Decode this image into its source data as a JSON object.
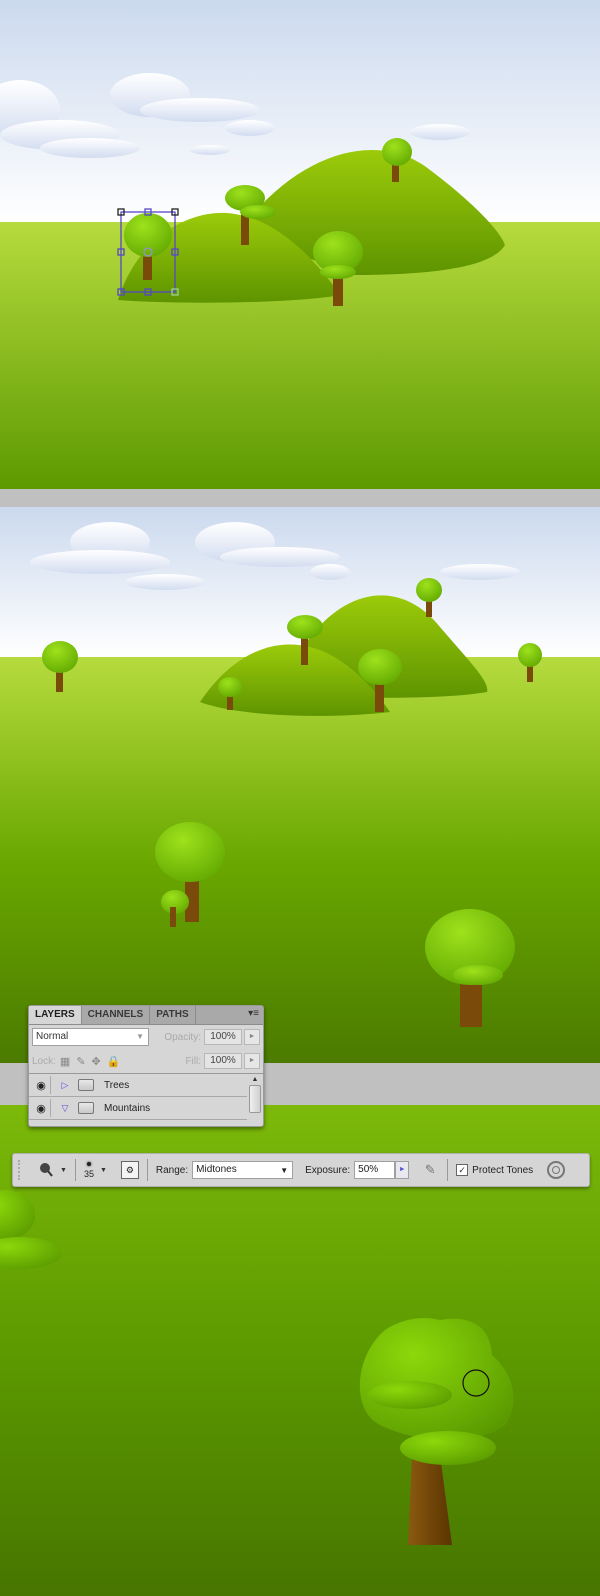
{
  "colors": {
    "sky_top": "#cfdcef",
    "sky_bottom": "#ffffff",
    "grass_light": "#b4db3a",
    "grass_dark": "#4b7a00",
    "hill": "#8cbd08",
    "foliage": "#84cc10",
    "trunk": "#7a4a0a",
    "separator": "#c0c0c0",
    "transform_box": "#5548c8"
  },
  "layers_panel": {
    "tabs": [
      {
        "label": "LAYERS",
        "active": true
      },
      {
        "label": "CHANNELS",
        "active": false
      },
      {
        "label": "PATHS",
        "active": false
      }
    ],
    "menu_icon": "panel-menu-icon",
    "blend_mode": "Normal",
    "opacity_label": "Opacity:",
    "opacity_value": "100%",
    "lock_label": "Lock:",
    "lock_icons": [
      "lock-transparent-icon",
      "lock-image-icon",
      "lock-position-icon",
      "lock-all-icon"
    ],
    "fill_label": "Fill:",
    "fill_value": "100%",
    "layers": [
      {
        "name": "Trees",
        "visible": true,
        "expanded": false,
        "type": "group"
      },
      {
        "name": "Mountains",
        "visible": true,
        "expanded": true,
        "type": "group"
      }
    ]
  },
  "options_bar": {
    "tool_icon": "burn-tool-icon",
    "brush_size": "35",
    "brush_panel_icon": "brush-panel-icon",
    "range_label": "Range:",
    "range_value": "Midtones",
    "exposure_label": "Exposure:",
    "exposure_value": "50%",
    "airbrush_icon": "airbrush-icon",
    "protect_tones_label": "Protect Tones",
    "protect_tones_checked": true,
    "pressure_icon": "tablet-pressure-icon"
  },
  "text": {
    "arrow_right": "►",
    "arrow_down": "▼",
    "arrow_up": "▲",
    "tri_right": "▷",
    "tri_down": "▽",
    "check": "✓",
    "menu": "▾≡",
    "eye": "👁"
  }
}
